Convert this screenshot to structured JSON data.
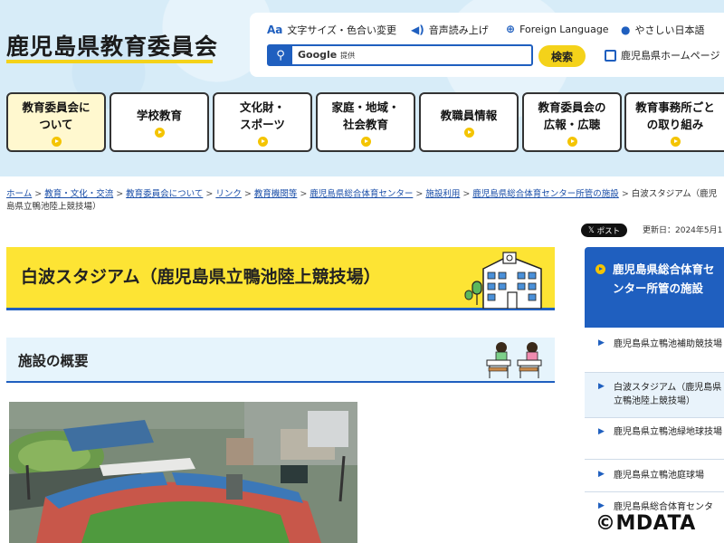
{
  "header": {
    "site_title": "鹿児島県教育委員会",
    "utility": {
      "text_size": "文字サイズ・色合い変更",
      "read_aloud": "音声読み上げ",
      "foreign_language": "Foreign Language",
      "easy_japanese": "やさしい日本語",
      "search_brand": "Google",
      "search_brand_suffix": "提供",
      "search_button": "検索",
      "prefecture_home": "鹿児島県ホームページ"
    }
  },
  "gnav": [
    {
      "line1": "教育委員会に",
      "line2": "ついて"
    },
    {
      "line1": "学校教育",
      "line2": ""
    },
    {
      "line1": "文化財・",
      "line2": "スポーツ"
    },
    {
      "line1": "家庭・地域・",
      "line2": "社会教育"
    },
    {
      "line1": "教職員情報",
      "line2": ""
    },
    {
      "line1": "教育委員会の",
      "line2": "広報・広聴"
    },
    {
      "line1": "教育事務所ごと",
      "line2": "の取り組み"
    }
  ],
  "breadcrumb": {
    "links": [
      "ホーム",
      "教育・文化・交流",
      "教育委員会について",
      "リンク",
      "教育機関等",
      "鹿児島県総合体育センター",
      "施設利用",
      "鹿児島県総合体育センター所管の施設"
    ],
    "current": "白波スタジアム（鹿児島県立鴨池陸上競技場）",
    "separator": ">"
  },
  "meta": {
    "x_post": "ポスト",
    "update_date": "更新日：2024年5月1"
  },
  "main": {
    "page_title": "白波スタジアム（鹿児島県立鴨池陸上競技場）",
    "section_title": "施設の概要"
  },
  "sidebar": {
    "heading": "鹿児島県総合体育センター所管の施設",
    "items": [
      "鹿児島県立鴨池補助競技場",
      "白波スタジアム（鹿児島県立鴨池陸上競技場）",
      "鹿児島県立鴨池緑地球技場",
      "鹿児島県立鴨池庭球場",
      "鹿児島県総合体育センタ"
    ]
  },
  "watermark": "©MDATA",
  "colors": {
    "accent_blue": "#1f5fbf",
    "accent_yellow": "#fde434",
    "header_bg": "#d7ecf8"
  }
}
